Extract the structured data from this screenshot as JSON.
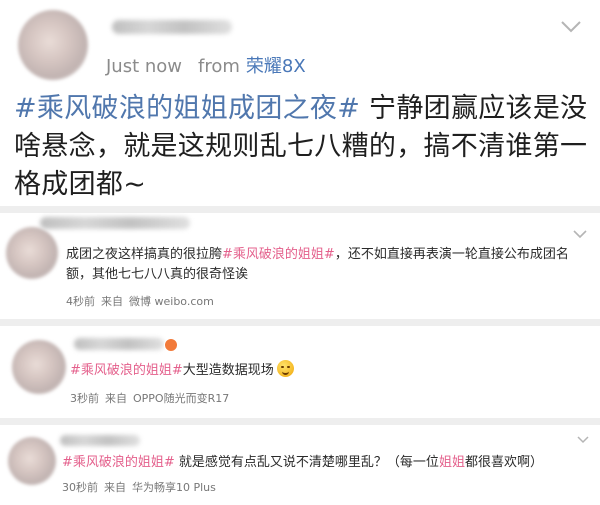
{
  "post": {
    "timestamp": "Just now",
    "from_label": "from",
    "device": "荣耀8X",
    "topic": "#乘风破浪的姐姐成团之夜#",
    "body": " 宁静团赢应该是没啥悬念，就是这规则乱七八糟的，搞不清谁第一格成团都~"
  },
  "comments": [
    {
      "pre": "成团之夜这样搞真的很拉胯",
      "topic": "#乘风破浪的姐姐#",
      "post": "，还不如直接再表演一轮直接公布成团名额，其他七七八八真的很奇怪诶",
      "time": "4秒前",
      "from": "来自",
      "device": "微博 weibo.com"
    },
    {
      "pre": "",
      "topic": "#乘风破浪的姐姐#",
      "post": "大型造数据现场",
      "emoji": "grinning-face-emoji",
      "time": "3秒前",
      "from": "来自",
      "device": "OPPO随光而变R17"
    },
    {
      "pre": "",
      "topic": "#乘风破浪的姐姐#",
      "post": " 就是感觉有点乱又说不清楚哪里乱？（每一位",
      "highlight": "姐姐",
      "post2": "都很喜欢啊）",
      "time": "30秒前",
      "from": "来自",
      "device": "华为畅享10 Plus"
    }
  ],
  "colors": {
    "topic_blue": "#5077ad",
    "topic_pink": "#e4608c",
    "separator": "#eeeeee"
  }
}
